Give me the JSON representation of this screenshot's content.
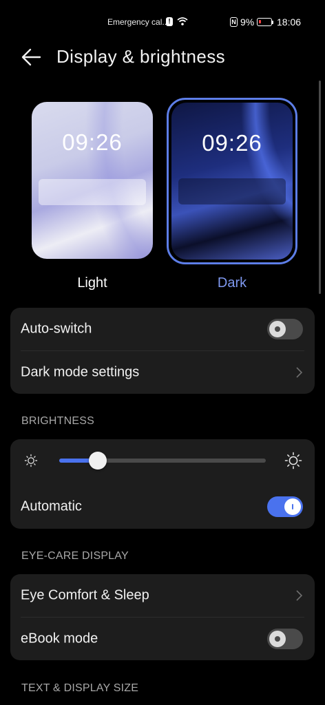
{
  "status_bar": {
    "carrier_text": "Emergency cal...",
    "alert_badge": "!",
    "nfc_badge": "N",
    "battery_percent": "9%",
    "time": "18:06"
  },
  "header": {
    "title": "Display & brightness"
  },
  "themes": {
    "light": {
      "preview_time": "09:26",
      "label": "Light"
    },
    "dark": {
      "preview_time": "09:26",
      "label": "Dark",
      "selected": true
    }
  },
  "mode_card": {
    "auto_switch_label": "Auto-switch",
    "auto_switch_on": false,
    "dark_mode_settings_label": "Dark mode settings"
  },
  "brightness": {
    "section_title": "BRIGHTNESS",
    "level": 0.186,
    "automatic_label": "Automatic",
    "automatic_on": true
  },
  "eye_care": {
    "section_title": "EYE-CARE DISPLAY",
    "eye_comfort_label": "Eye Comfort & Sleep",
    "ebook_label": "eBook mode",
    "ebook_on": false
  },
  "text_display": {
    "section_title": "TEXT & DISPLAY SIZE"
  },
  "colors": {
    "accent": "#4a72ee",
    "selected_label": "#7f99f0",
    "card_bg": "#1d1d1d"
  }
}
